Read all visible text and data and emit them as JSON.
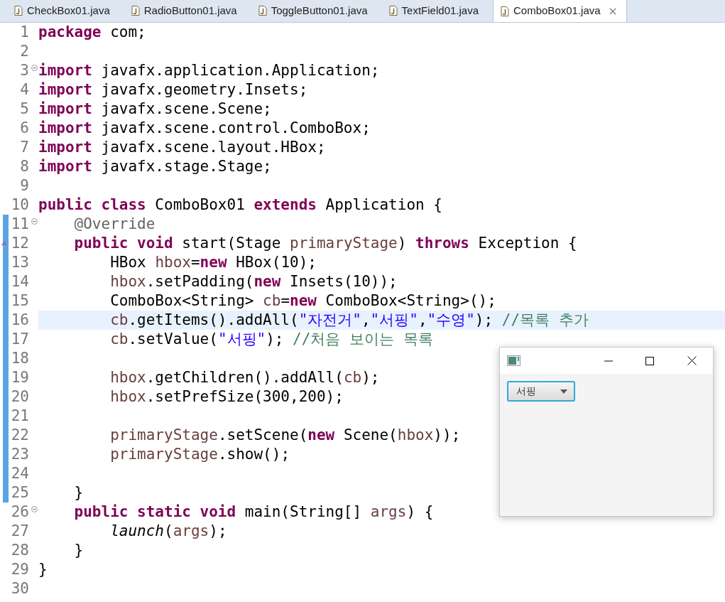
{
  "tabs": [
    {
      "label": "CheckBox01.java",
      "selected": false
    },
    {
      "label": "RadioButton01.java",
      "selected": false
    },
    {
      "label": "ToggleButton01.java",
      "selected": false
    },
    {
      "label": "TextField01.java",
      "selected": false
    },
    {
      "label": "ComboBox01.java",
      "selected": true
    }
  ],
  "editor": {
    "lines": [
      {
        "number": "1",
        "fold": false,
        "changed": false,
        "current": false,
        "override": false,
        "tokens": [
          {
            "kind": "kw",
            "text": "package"
          },
          {
            "kind": "plain",
            "text": " com;"
          }
        ]
      },
      {
        "number": "2",
        "fold": false,
        "changed": false,
        "current": false,
        "override": false
      },
      {
        "number": "3",
        "fold": true,
        "changed": false,
        "current": false,
        "override": false,
        "tokens": [
          {
            "kind": "kw",
            "text": "import"
          },
          {
            "kind": "plain",
            "text": " javafx.application.Application;"
          }
        ]
      },
      {
        "number": "4",
        "fold": false,
        "changed": false,
        "current": false,
        "override": false,
        "tokens": [
          {
            "kind": "kw",
            "text": "import"
          },
          {
            "kind": "plain",
            "text": " javafx.geometry.Insets;"
          }
        ]
      },
      {
        "number": "5",
        "fold": false,
        "changed": false,
        "current": false,
        "override": false,
        "tokens": [
          {
            "kind": "kw",
            "text": "import"
          },
          {
            "kind": "plain",
            "text": " javafx.scene.Scene;"
          }
        ]
      },
      {
        "number": "6",
        "fold": false,
        "changed": false,
        "current": false,
        "override": false,
        "tokens": [
          {
            "kind": "kw",
            "text": "import"
          },
          {
            "kind": "plain",
            "text": " javafx.scene.control.ComboBox;"
          }
        ]
      },
      {
        "number": "7",
        "fold": false,
        "changed": false,
        "current": false,
        "override": false,
        "tokens": [
          {
            "kind": "kw",
            "text": "import"
          },
          {
            "kind": "plain",
            "text": " javafx.scene.layout.HBox;"
          }
        ]
      },
      {
        "number": "8",
        "fold": false,
        "changed": false,
        "current": false,
        "override": false,
        "tokens": [
          {
            "kind": "kw",
            "text": "import"
          },
          {
            "kind": "plain",
            "text": " javafx.stage.Stage;"
          }
        ]
      },
      {
        "number": "9",
        "fold": false,
        "changed": false,
        "current": false,
        "override": false
      },
      {
        "number": "10",
        "fold": false,
        "changed": false,
        "current": false,
        "override": false,
        "tokens": [
          {
            "kind": "kw",
            "text": "public class"
          },
          {
            "kind": "plain",
            "text": " ComboBox01 "
          },
          {
            "kind": "kw",
            "text": "extends"
          },
          {
            "kind": "plain",
            "text": " Application {"
          }
        ]
      },
      {
        "number": "11",
        "fold": true,
        "changed": true,
        "current": false,
        "override": false,
        "tokens": [
          {
            "kind": "ann",
            "text": "    @Override"
          }
        ]
      },
      {
        "number": "12",
        "fold": false,
        "changed": true,
        "current": false,
        "override": true,
        "tokens": [
          {
            "kind": "kw",
            "text": "    public void"
          },
          {
            "kind": "plain",
            "text": " start(Stage "
          },
          {
            "kind": "var",
            "text": "primaryStage"
          },
          {
            "kind": "plain",
            "text": ") "
          },
          {
            "kind": "kw",
            "text": "throws"
          },
          {
            "kind": "plain",
            "text": " Exception {"
          }
        ]
      },
      {
        "number": "13",
        "fold": false,
        "changed": true,
        "current": false,
        "override": false,
        "tokens": [
          {
            "kind": "plain",
            "text": "        HBox "
          },
          {
            "kind": "var",
            "text": "hbox"
          },
          {
            "kind": "plain",
            "text": "="
          },
          {
            "kind": "kw",
            "text": "new"
          },
          {
            "kind": "plain",
            "text": " HBox(10);"
          }
        ]
      },
      {
        "number": "14",
        "fold": false,
        "changed": true,
        "current": false,
        "override": false,
        "tokens": [
          {
            "kind": "var",
            "text": "        hbox"
          },
          {
            "kind": "plain",
            "text": ".setPadding("
          },
          {
            "kind": "kw",
            "text": "new"
          },
          {
            "kind": "plain",
            "text": " Insets(10));"
          }
        ]
      },
      {
        "number": "15",
        "fold": false,
        "changed": true,
        "current": false,
        "override": false,
        "tokens": [
          {
            "kind": "plain",
            "text": "        ComboBox<String> "
          },
          {
            "kind": "var",
            "text": "cb"
          },
          {
            "kind": "plain",
            "text": "="
          },
          {
            "kind": "kw",
            "text": "new"
          },
          {
            "kind": "plain",
            "text": " ComboBox<String>();"
          }
        ]
      },
      {
        "number": "16",
        "fold": false,
        "changed": true,
        "current": true,
        "override": false,
        "tokens": [
          {
            "kind": "var",
            "text": "        cb"
          },
          {
            "kind": "plain",
            "text": ".getItems().addAll("
          },
          {
            "kind": "str",
            "text": "\"자전거\""
          },
          {
            "kind": "plain",
            "text": ","
          },
          {
            "kind": "str",
            "text": "\"서핑\""
          },
          {
            "kind": "plain",
            "text": ","
          },
          {
            "kind": "str",
            "text": "\"수영\""
          },
          {
            "kind": "plain",
            "text": "); "
          },
          {
            "kind": "com",
            "text": "//목록 추가"
          }
        ]
      },
      {
        "number": "17",
        "fold": false,
        "changed": true,
        "current": false,
        "override": false,
        "tokens": [
          {
            "kind": "var",
            "text": "        cb"
          },
          {
            "kind": "plain",
            "text": ".setValue("
          },
          {
            "kind": "str",
            "text": "\"서핑\""
          },
          {
            "kind": "plain",
            "text": "); "
          },
          {
            "kind": "com",
            "text": "//처음 보이는 목록"
          }
        ]
      },
      {
        "number": "18",
        "fold": false,
        "changed": true,
        "current": false,
        "override": false
      },
      {
        "number": "19",
        "fold": false,
        "changed": true,
        "current": false,
        "override": false,
        "tokens": [
          {
            "kind": "var",
            "text": "        hbox"
          },
          {
            "kind": "plain",
            "text": ".getChildren().addAll("
          },
          {
            "kind": "var",
            "text": "cb"
          },
          {
            "kind": "plain",
            "text": ");"
          }
        ]
      },
      {
        "number": "20",
        "fold": false,
        "changed": true,
        "current": false,
        "override": false,
        "tokens": [
          {
            "kind": "var",
            "text": "        hbox"
          },
          {
            "kind": "plain",
            "text": ".setPrefSize(300,200);"
          }
        ]
      },
      {
        "number": "21",
        "fold": false,
        "changed": true,
        "current": false,
        "override": false
      },
      {
        "number": "22",
        "fold": false,
        "changed": true,
        "current": false,
        "override": false,
        "tokens": [
          {
            "kind": "var",
            "text": "        primaryStage"
          },
          {
            "kind": "plain",
            "text": ".setScene("
          },
          {
            "kind": "kw",
            "text": "new"
          },
          {
            "kind": "plain",
            "text": " Scene("
          },
          {
            "kind": "var",
            "text": "hbox"
          },
          {
            "kind": "plain",
            "text": "));"
          }
        ]
      },
      {
        "number": "23",
        "fold": false,
        "changed": true,
        "current": false,
        "override": false,
        "tokens": [
          {
            "kind": "var",
            "text": "        primaryStage"
          },
          {
            "kind": "plain",
            "text": ".show();"
          }
        ]
      },
      {
        "number": "24",
        "fold": false,
        "changed": true,
        "current": false,
        "override": false
      },
      {
        "number": "25",
        "fold": false,
        "changed": true,
        "current": false,
        "override": false,
        "tokens": [
          {
            "kind": "plain",
            "text": "    }"
          }
        ]
      },
      {
        "number": "26",
        "fold": true,
        "changed": false,
        "current": false,
        "override": false,
        "tokens": [
          {
            "kind": "kw",
            "text": "    public static void"
          },
          {
            "kind": "plain",
            "text": " main(String[] "
          },
          {
            "kind": "var",
            "text": "args"
          },
          {
            "kind": "plain",
            "text": ") {"
          }
        ]
      },
      {
        "number": "27",
        "fold": false,
        "changed": false,
        "current": false,
        "override": false,
        "tokens": [
          {
            "kind": "it",
            "text": "        launch"
          },
          {
            "kind": "plain",
            "text": "("
          },
          {
            "kind": "var",
            "text": "args"
          },
          {
            "kind": "plain",
            "text": ");"
          }
        ]
      },
      {
        "number": "28",
        "fold": false,
        "changed": false,
        "current": false,
        "override": false,
        "tokens": [
          {
            "kind": "plain",
            "text": "    }"
          }
        ]
      },
      {
        "number": "29",
        "fold": false,
        "changed": false,
        "current": false,
        "override": false,
        "tokens": [
          {
            "kind": "plain",
            "text": "}"
          }
        ]
      },
      {
        "number": "30",
        "fold": false,
        "changed": false,
        "current": false,
        "override": false
      }
    ]
  },
  "app_window": {
    "combo_box": {
      "value": "서핑",
      "focused": true
    }
  }
}
